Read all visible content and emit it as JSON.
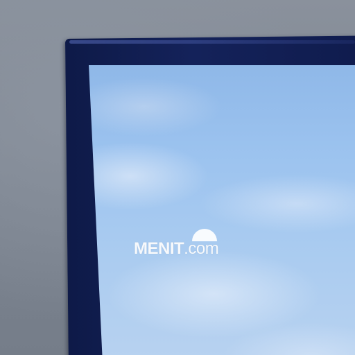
{
  "watermark": {
    "brand": "MENIT",
    "suffix": ".com"
  },
  "colors": {
    "wall": "#7f8793",
    "bezel": "#14225a",
    "sky": "#9cc3ef",
    "watermark": "#ffffff"
  },
  "icons": {
    "watermark_logo": "semicircle-dome-icon"
  }
}
